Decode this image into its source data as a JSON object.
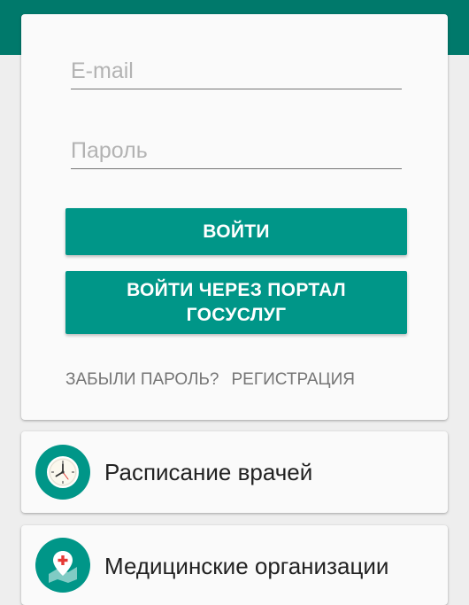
{
  "colors": {
    "primary_dark": "#00796b",
    "primary": "#009688",
    "background": "#eeeeee",
    "card": "#fafafa"
  },
  "login": {
    "email_placeholder": "E-mail",
    "password_placeholder": "Пароль",
    "login_button": "ВОЙТИ",
    "gosuslugi_button": "ВОЙТИ ЧЕРЕЗ ПОРТАЛ ГОСУСЛУГ",
    "forgot_password": "ЗАБЫЛИ ПАРОЛЬ?",
    "register": "РЕГИСТРАЦИЯ"
  },
  "menu": [
    {
      "label": "Расписание врачей",
      "icon": "clock-icon"
    },
    {
      "label": "Медицинские организации",
      "icon": "map-pin-medical-icon"
    }
  ]
}
